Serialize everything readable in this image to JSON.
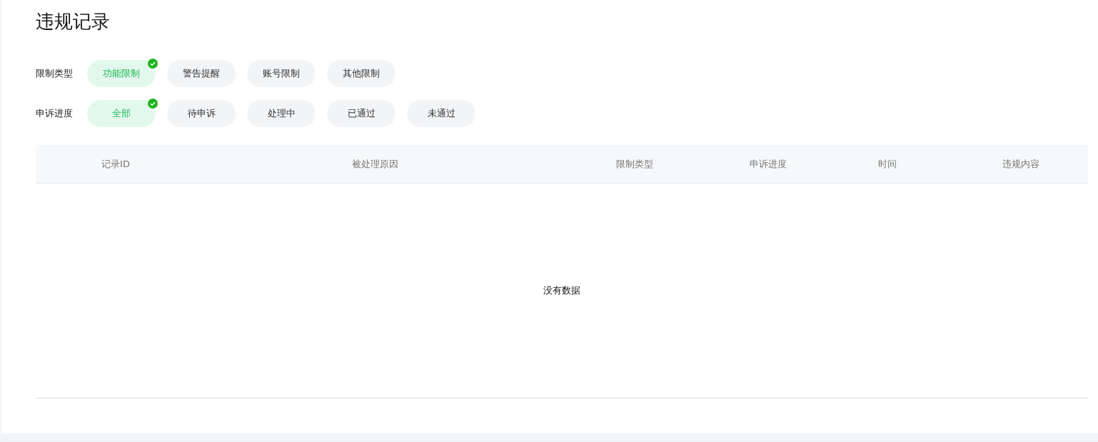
{
  "title": "违规记录",
  "filters": [
    {
      "label": "限制类型",
      "options": [
        {
          "label": "功能限制",
          "selected": true
        },
        {
          "label": "警告提醒",
          "selected": false
        },
        {
          "label": "账号限制",
          "selected": false
        },
        {
          "label": "其他限制",
          "selected": false
        }
      ]
    },
    {
      "label": "申诉进度",
      "options": [
        {
          "label": "全部",
          "selected": true
        },
        {
          "label": "待申诉",
          "selected": false
        },
        {
          "label": "处理中",
          "selected": false
        },
        {
          "label": "已通过",
          "selected": false
        },
        {
          "label": "未通过",
          "selected": false
        }
      ]
    }
  ],
  "table": {
    "columns": [
      "记录ID",
      "被处理原因",
      "限制类型",
      "申诉进度",
      "时间",
      "违规内容"
    ],
    "empty_text": "没有数据"
  }
}
